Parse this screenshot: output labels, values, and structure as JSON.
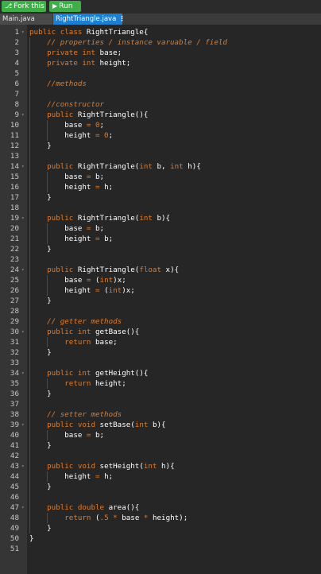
{
  "toolbar": {
    "fork_label": "Fork this",
    "run_label": "Run",
    "fork_icon": "fork-icon",
    "run_icon": "play-icon"
  },
  "tabs": [
    {
      "label": "Main.java",
      "active": false
    },
    {
      "label": "RightTriangle.java",
      "active": true,
      "menu_icon": "⋮"
    }
  ],
  "colors": {
    "keyword": "#e07c2c",
    "plain": "#ffffff",
    "tab_active": "#1e7fd1",
    "button": "#3fae49",
    "gutter": "#353535",
    "background": "#262626"
  },
  "editor": {
    "lines": [
      {
        "n": "1",
        "fold": "▾",
        "tokens": [
          [
            "kw",
            "public class "
          ],
          [
            "pl",
            "RightTriangle{"
          ]
        ]
      },
      {
        "n": "2",
        "tokens": [
          [
            "pl",
            "    "
          ],
          [
            "cm",
            "// properties / instance varuable / field"
          ]
        ]
      },
      {
        "n": "3",
        "tokens": [
          [
            "pl",
            "    "
          ],
          [
            "kw",
            "private int "
          ],
          [
            "pl",
            "base;"
          ]
        ]
      },
      {
        "n": "4",
        "tokens": [
          [
            "pl",
            "    "
          ],
          [
            "kw",
            "private int "
          ],
          [
            "pl",
            "height;"
          ]
        ]
      },
      {
        "n": "5",
        "tokens": []
      },
      {
        "n": "6",
        "tokens": [
          [
            "pl",
            "    "
          ],
          [
            "cm",
            "//methods"
          ]
        ]
      },
      {
        "n": "7",
        "tokens": []
      },
      {
        "n": "8",
        "tokens": [
          [
            "pl",
            "    "
          ],
          [
            "cm",
            "//constructor"
          ]
        ]
      },
      {
        "n": "9",
        "fold": "▾",
        "tokens": [
          [
            "pl",
            "    "
          ],
          [
            "kw",
            "public "
          ],
          [
            "pl",
            "RightTriangle(){"
          ]
        ]
      },
      {
        "n": "10",
        "tokens": [
          [
            "pl",
            "        base "
          ],
          [
            "op",
            "= 0"
          ],
          [
            "pl",
            ";"
          ]
        ]
      },
      {
        "n": "11",
        "tokens": [
          [
            "pl",
            "        height "
          ],
          [
            "op",
            "= 0"
          ],
          [
            "pl",
            ";"
          ]
        ]
      },
      {
        "n": "12",
        "tokens": [
          [
            "pl",
            "    }"
          ]
        ]
      },
      {
        "n": "13",
        "tokens": []
      },
      {
        "n": "14",
        "fold": "▾",
        "tokens": [
          [
            "pl",
            "    "
          ],
          [
            "kw",
            "public "
          ],
          [
            "pl",
            "RightTriangle("
          ],
          [
            "kw",
            "int "
          ],
          [
            "pl",
            "b, "
          ],
          [
            "kw",
            "int "
          ],
          [
            "pl",
            "h){"
          ]
        ]
      },
      {
        "n": "15",
        "tokens": [
          [
            "pl",
            "        base "
          ],
          [
            "op",
            "= "
          ],
          [
            "pl",
            "b;"
          ]
        ]
      },
      {
        "n": "16",
        "tokens": [
          [
            "pl",
            "        height "
          ],
          [
            "op",
            "= "
          ],
          [
            "pl",
            "h;"
          ]
        ]
      },
      {
        "n": "17",
        "tokens": [
          [
            "pl",
            "    }"
          ]
        ]
      },
      {
        "n": "18",
        "tokens": []
      },
      {
        "n": "19",
        "fold": "▾",
        "tokens": [
          [
            "pl",
            "    "
          ],
          [
            "kw",
            "public "
          ],
          [
            "pl",
            "RightTriangle("
          ],
          [
            "kw",
            "int "
          ],
          [
            "pl",
            "b){"
          ]
        ]
      },
      {
        "n": "20",
        "tokens": [
          [
            "pl",
            "        base "
          ],
          [
            "op",
            "= "
          ],
          [
            "pl",
            "b;"
          ]
        ]
      },
      {
        "n": "21",
        "tokens": [
          [
            "pl",
            "        height "
          ],
          [
            "op",
            "= "
          ],
          [
            "pl",
            "b;"
          ]
        ]
      },
      {
        "n": "22",
        "tokens": [
          [
            "pl",
            "    }"
          ]
        ]
      },
      {
        "n": "23",
        "tokens": []
      },
      {
        "n": "24",
        "fold": "▾",
        "tokens": [
          [
            "pl",
            "    "
          ],
          [
            "kw",
            "public "
          ],
          [
            "pl",
            "RightTriangle("
          ],
          [
            "kw",
            "float "
          ],
          [
            "pl",
            "x){"
          ]
        ]
      },
      {
        "n": "25",
        "tokens": [
          [
            "pl",
            "        base "
          ],
          [
            "op",
            "= "
          ],
          [
            "pl",
            "("
          ],
          [
            "kw",
            "int"
          ],
          [
            "pl",
            ")x;"
          ]
        ]
      },
      {
        "n": "26",
        "tokens": [
          [
            "pl",
            "        height "
          ],
          [
            "op",
            "= "
          ],
          [
            "pl",
            "("
          ],
          [
            "kw",
            "int"
          ],
          [
            "pl",
            ")x;"
          ]
        ]
      },
      {
        "n": "27",
        "tokens": [
          [
            "pl",
            "    }"
          ]
        ]
      },
      {
        "n": "28",
        "tokens": []
      },
      {
        "n": "29",
        "tokens": [
          [
            "pl",
            "    "
          ],
          [
            "cm",
            "// getter methods"
          ]
        ]
      },
      {
        "n": "30",
        "fold": "▾",
        "tokens": [
          [
            "pl",
            "    "
          ],
          [
            "kw",
            "public int "
          ],
          [
            "pl",
            "getBase(){"
          ]
        ]
      },
      {
        "n": "31",
        "tokens": [
          [
            "pl",
            "        "
          ],
          [
            "kw",
            "return "
          ],
          [
            "pl",
            "base;"
          ]
        ]
      },
      {
        "n": "32",
        "tokens": [
          [
            "pl",
            "    }"
          ]
        ]
      },
      {
        "n": "33",
        "tokens": []
      },
      {
        "n": "34",
        "fold": "▾",
        "tokens": [
          [
            "pl",
            "    "
          ],
          [
            "kw",
            "public int "
          ],
          [
            "pl",
            "getHeight(){"
          ]
        ]
      },
      {
        "n": "35",
        "tokens": [
          [
            "pl",
            "        "
          ],
          [
            "kw",
            "return "
          ],
          [
            "pl",
            "height;"
          ]
        ]
      },
      {
        "n": "36",
        "tokens": [
          [
            "pl",
            "    }"
          ]
        ]
      },
      {
        "n": "37",
        "tokens": []
      },
      {
        "n": "38",
        "tokens": [
          [
            "pl",
            "    "
          ],
          [
            "cm",
            "// setter methods"
          ]
        ]
      },
      {
        "n": "39",
        "fold": "▾",
        "tokens": [
          [
            "pl",
            "    "
          ],
          [
            "kw",
            "public void "
          ],
          [
            "pl",
            "setBase("
          ],
          [
            "kw",
            "int "
          ],
          [
            "pl",
            "b){"
          ]
        ]
      },
      {
        "n": "40",
        "tokens": [
          [
            "pl",
            "        base "
          ],
          [
            "op",
            "= "
          ],
          [
            "pl",
            "b;"
          ]
        ]
      },
      {
        "n": "41",
        "tokens": [
          [
            "pl",
            "    }"
          ]
        ]
      },
      {
        "n": "42",
        "tokens": []
      },
      {
        "n": "43",
        "fold": "▾",
        "tokens": [
          [
            "pl",
            "    "
          ],
          [
            "kw",
            "public void "
          ],
          [
            "pl",
            "setHeight("
          ],
          [
            "kw",
            "int "
          ],
          [
            "pl",
            "h){"
          ]
        ]
      },
      {
        "n": "44",
        "tokens": [
          [
            "pl",
            "        height "
          ],
          [
            "op",
            "= "
          ],
          [
            "pl",
            "h;"
          ]
        ]
      },
      {
        "n": "45",
        "tokens": [
          [
            "pl",
            "    }"
          ]
        ]
      },
      {
        "n": "46",
        "tokens": []
      },
      {
        "n": "47",
        "fold": "▾",
        "tokens": [
          [
            "pl",
            "    "
          ],
          [
            "kw",
            "public double "
          ],
          [
            "pl",
            "area(){"
          ]
        ]
      },
      {
        "n": "48",
        "tokens": [
          [
            "pl",
            "        "
          ],
          [
            "kw",
            "return "
          ],
          [
            "pl",
            "("
          ],
          [
            "op",
            ".5 * "
          ],
          [
            "pl",
            "base "
          ],
          [
            "op",
            "* "
          ],
          [
            "pl",
            "height);"
          ]
        ]
      },
      {
        "n": "49",
        "tokens": [
          [
            "pl",
            "    }"
          ]
        ]
      },
      {
        "n": "50",
        "tokens": [
          [
            "pl",
            "}"
          ]
        ]
      },
      {
        "n": "51",
        "tokens": []
      }
    ]
  }
}
